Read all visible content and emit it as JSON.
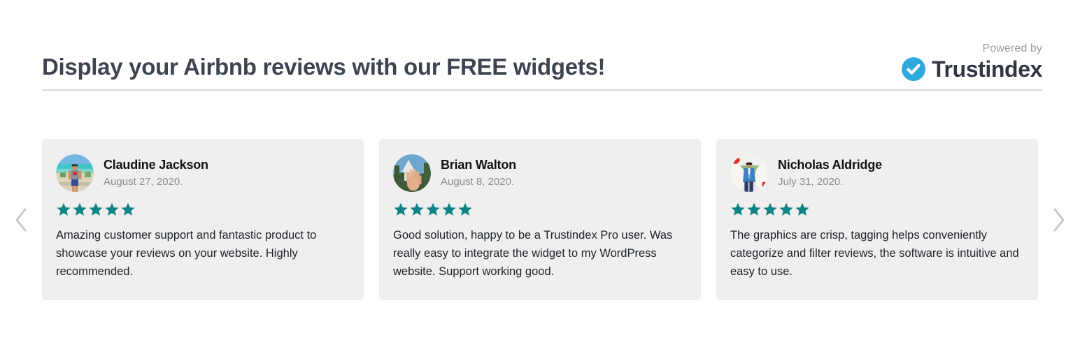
{
  "header": {
    "title": "Display your Airbnb reviews with our FREE widgets!",
    "powered_by": "Powered by",
    "brand_name": "Trustindex",
    "brand_icon": "check-circle-icon",
    "brand_color": "#2fa8dd",
    "title_color": "#3d4450"
  },
  "carousel": {
    "prev_icon": "chevron-left-icon",
    "next_icon": "chevron-right-icon",
    "arrow_color": "#cccccc",
    "star_color": "#0e8384",
    "card_background": "#efefef",
    "reviews": [
      {
        "name": "Claudine Jackson",
        "date": "August 27, 2020.",
        "rating": 5,
        "rating_label": "5 out of 5 stars",
        "text": "Amazing customer support and fantastic product to showcase your reviews on your website. Highly recommended.",
        "avatar": "avatar-beach-photo"
      },
      {
        "name": "Brian Walton",
        "date": "August 8, 2020.",
        "rating": 5,
        "rating_label": "5 out of 5 stars",
        "text": "Good solution, happy to be a Trustindex Pro user. Was really easy to integrate the widget to my WordPress website. Support working good.",
        "avatar": "avatar-hand-photo"
      },
      {
        "name": "Nicholas Aldridge",
        "date": "July 31, 2020.",
        "rating": 5,
        "rating_label": "5 out of 5 stars",
        "text": "The graphics are crisp, tagging helps conveniently categorize and filter reviews, the software is intuitive and easy to use.",
        "avatar": "avatar-person-suit-photo"
      }
    ]
  }
}
